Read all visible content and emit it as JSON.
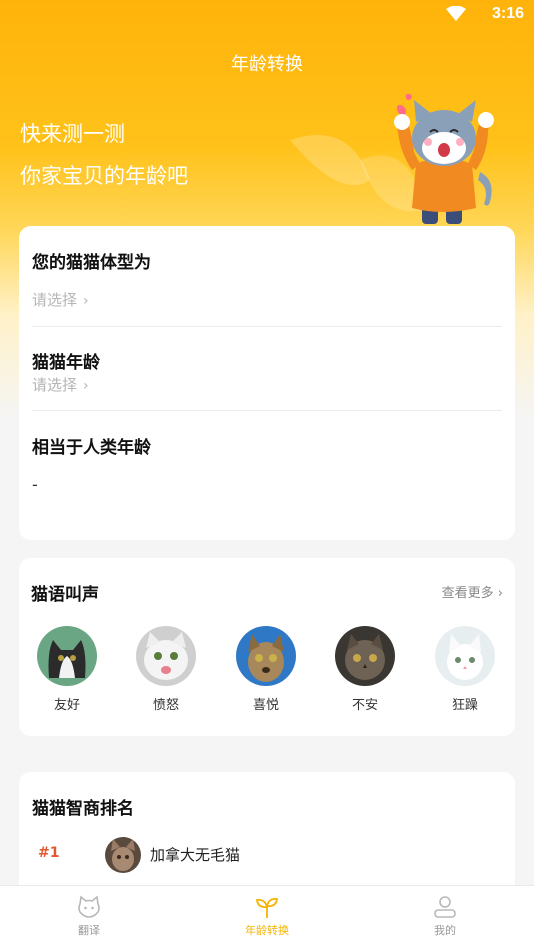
{
  "status": {
    "time": "3:16"
  },
  "header": {
    "title": "年龄转换"
  },
  "hero": {
    "line1": "快来测一测",
    "line2": "你家宝贝的年龄吧"
  },
  "calculator": {
    "body_type_label": "您的猫猫体型为",
    "body_type_value": "请选择",
    "age_label": "猫猫年龄",
    "age_value": "请选择",
    "human_age_label": "相当于人类年龄",
    "human_age_value": "-"
  },
  "sounds": {
    "title": "猫语叫声",
    "more": "查看更多",
    "items": [
      {
        "label": "友好"
      },
      {
        "label": "愤怒"
      },
      {
        "label": "喜悦"
      },
      {
        "label": "不安"
      },
      {
        "label": "狂躁"
      }
    ]
  },
  "ranking": {
    "title": "猫猫智商排名",
    "items": [
      {
        "rank": "#1",
        "name": "加拿大无毛猫"
      }
    ]
  },
  "tabbar": {
    "items": [
      {
        "label": "翻译",
        "icon": "cat-face-icon"
      },
      {
        "label": "年龄转换",
        "icon": "sprout-icon"
      },
      {
        "label": "我的",
        "icon": "person-icon"
      }
    ],
    "active_color": "#f5b400"
  },
  "colors": {
    "accent": "#ffb30a",
    "rank": "#e4572e"
  }
}
